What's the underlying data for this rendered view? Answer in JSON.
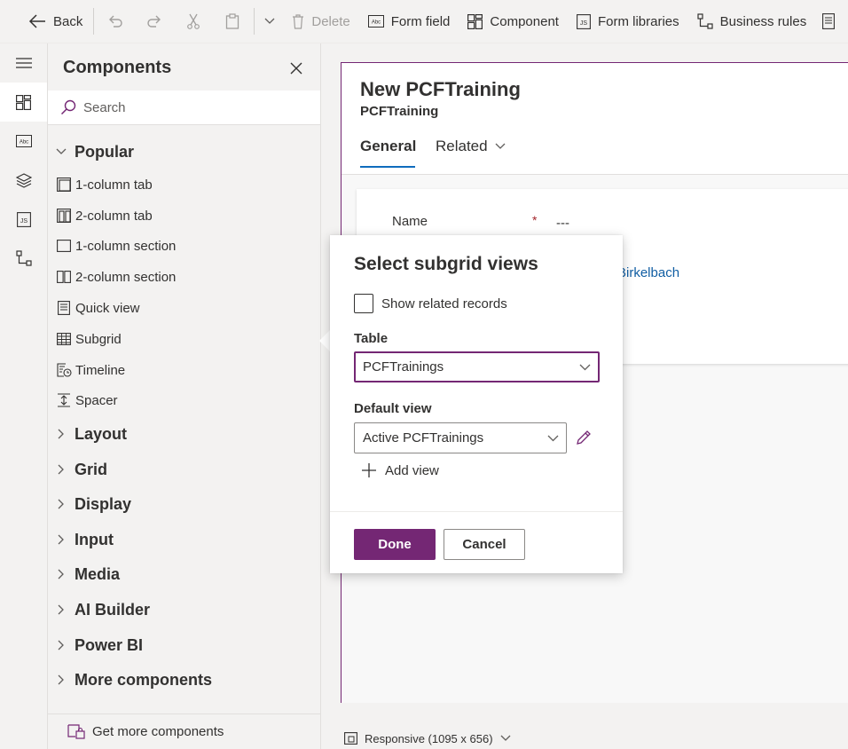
{
  "toolbar": {
    "back_label": "Back",
    "delete_label": "Delete",
    "form_field_label": "Form field",
    "component_label": "Component",
    "form_libraries_label": "Form libraries",
    "business_rules_label": "Business rules"
  },
  "panel": {
    "title": "Components",
    "search_placeholder": "Search",
    "groups": {
      "popular": "Popular",
      "layout": "Layout",
      "grid": "Grid",
      "display": "Display",
      "input": "Input",
      "media": "Media",
      "ai_builder": "AI Builder",
      "power_bi": "Power BI",
      "more_components": "More components"
    },
    "items": [
      "1-column tab",
      "2-column tab",
      "1-column section",
      "2-column section",
      "Quick view",
      "Subgrid",
      "Timeline",
      "Spacer"
    ],
    "footer_label": "Get more components"
  },
  "form": {
    "title": "New PCFTraining",
    "entity": "PCFTraining",
    "tabs": {
      "general": "General",
      "related": "Related"
    },
    "field_name_label": "Name",
    "required_mark": "*",
    "field_name_value": "---",
    "owner_link_partial": "Birkelbach"
  },
  "bottom": {
    "responsive_label": "Responsive (1095 x 656)"
  },
  "dialog": {
    "title": "Select subgrid views",
    "show_related_label": "Show related records",
    "table_label": "Table",
    "table_value": "PCFTrainings",
    "default_view_label": "Default view",
    "default_view_value": "Active PCFTrainings",
    "add_view_label": "Add view",
    "done_label": "Done",
    "cancel_label": "Cancel"
  },
  "colors": {
    "accent": "#742774",
    "link": "#115ea3",
    "required": "#a4262c"
  }
}
